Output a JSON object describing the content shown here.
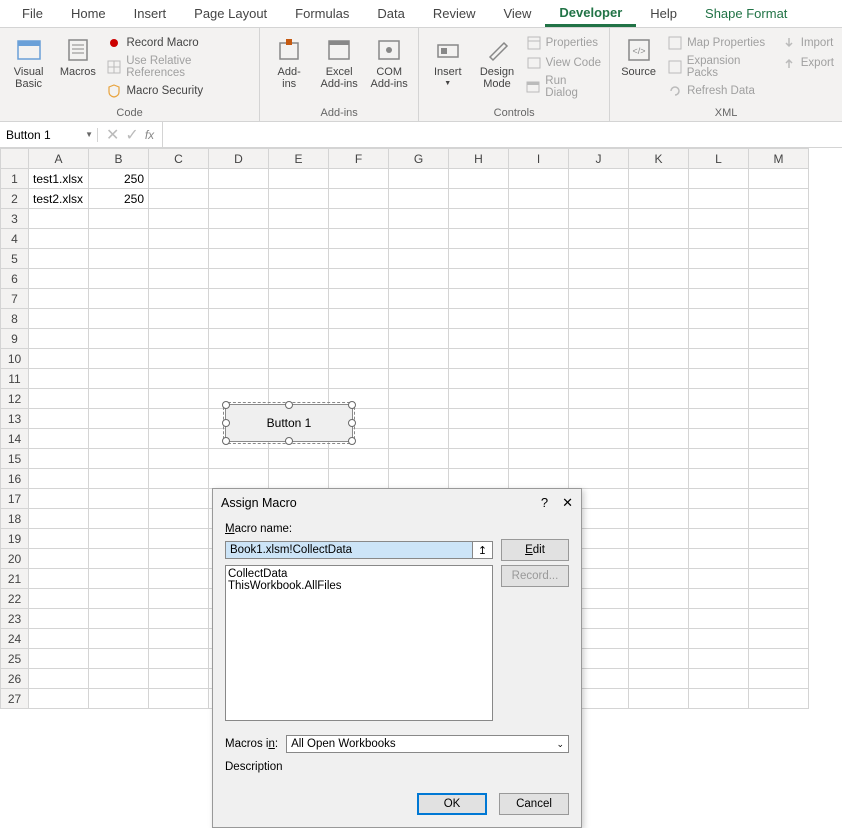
{
  "tabs": [
    "File",
    "Home",
    "Insert",
    "Page Layout",
    "Formulas",
    "Data",
    "Review",
    "View",
    "Developer",
    "Help",
    "Shape Format"
  ],
  "active_tab": "Developer",
  "ribbon": {
    "code": {
      "visual_basic": "Visual\nBasic",
      "macros": "Macros",
      "record_macro": "Record Macro",
      "use_relative": "Use Relative References",
      "macro_security": "Macro Security",
      "label": "Code"
    },
    "addins": {
      "addins": "Add-\nins",
      "excel_addins": "Excel\nAdd-ins",
      "com_addins": "COM\nAdd-ins",
      "label": "Add-ins"
    },
    "controls": {
      "insert": "Insert",
      "design_mode": "Design\nMode",
      "properties": "Properties",
      "view_code": "View Code",
      "run_dialog": "Run Dialog",
      "label": "Controls"
    },
    "xml": {
      "source": "Source",
      "map_properties": "Map Properties",
      "expansion_packs": "Expansion Packs",
      "refresh_data": "Refresh Data",
      "import": "Import",
      "export": "Export",
      "label": "XML"
    }
  },
  "name_box": "Button 1",
  "columns": [
    "A",
    "B",
    "C",
    "D",
    "E",
    "F",
    "G",
    "H",
    "I",
    "J",
    "K",
    "L",
    "M"
  ],
  "rows": 27,
  "cells": {
    "A1": "test1.xlsx",
    "B1": "250",
    "A2": "test2.xlsx",
    "B2": "250"
  },
  "shape_button_label": "Button 1",
  "dialog": {
    "title": "Assign Macro",
    "macro_name_label": "Macro name:",
    "macro_name_value": "Book1.xlsm!CollectData",
    "edit": "Edit",
    "record": "Record...",
    "list": [
      "CollectData",
      "ThisWorkbook.AllFiles"
    ],
    "macros_in_label": "Macros in:",
    "macros_in_value": "All Open Workbooks",
    "description_label": "Description",
    "ok": "OK",
    "cancel": "Cancel"
  }
}
